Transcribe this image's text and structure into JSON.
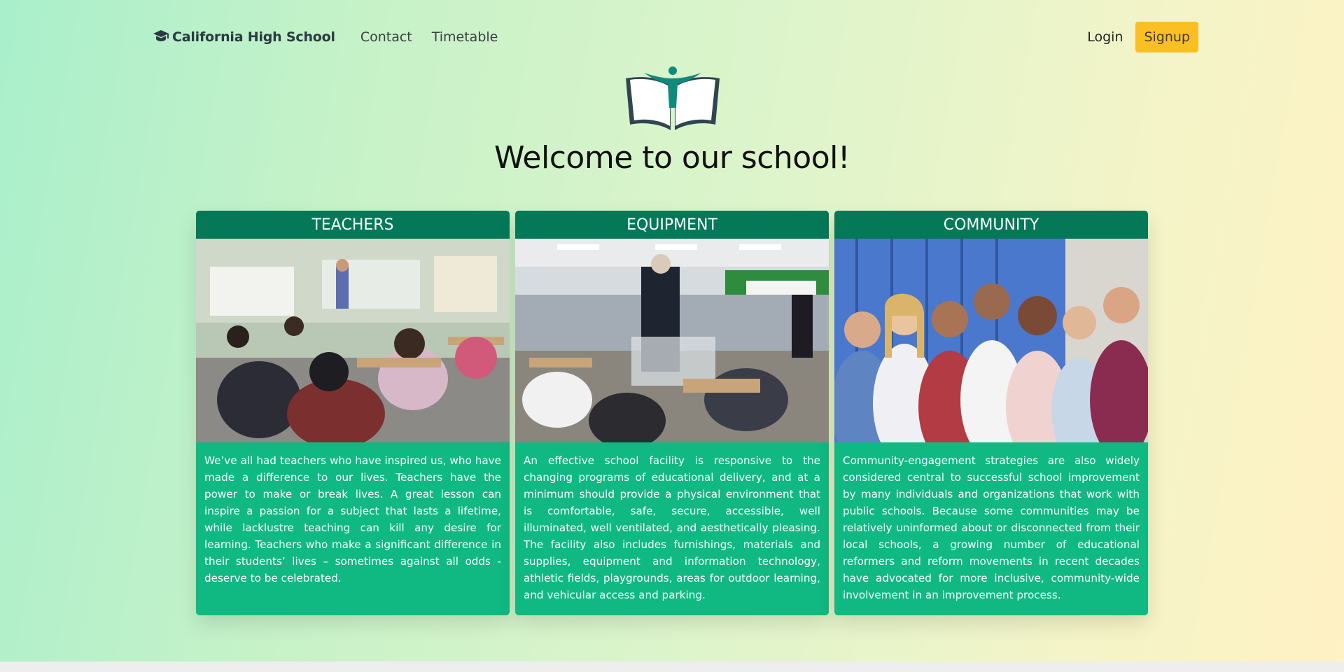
{
  "navbar": {
    "brand": "California High School",
    "links": [
      "Contact",
      "Timetable"
    ],
    "login": "Login",
    "signup": "Signup"
  },
  "hero": {
    "title": "Welcome to our school!"
  },
  "cards": [
    {
      "title": "TEACHERS",
      "image": "classroom-photo",
      "text": "We’ve all had teachers who have inspired us, who have made a difference to our lives. Teachers have the power to make or break lives. A great lesson can inspire a passion for a subject that lasts a lifetime, while lacklustre teaching can kill any desire for learning. Teachers who make a significant difference in their students’ lives – sometimes against all odds - deserve to be celebrated."
    },
    {
      "title": "EQUIPMENT",
      "image": "classroom-visit-photo",
      "text": "An effective school facility is responsive to the changing programs of educational delivery, and at a minimum should provide a physical environment that is comfortable, safe, secure, accessible, well illuminated, well ventilated, and aesthetically pleasing. The facility also includes furnishings, materials and supplies, equipment and information technology, athletic fields, playgrounds, areas for outdoor learning, and vehicular access and parking."
    },
    {
      "title": "COMMUNITY",
      "image": "students-lockers-photo",
      "text": "Community-engagement strategies are also widely considered central to successful school improvement by many individuals and organizations that work with public schools. Because some communities may be relatively uninformed about or disconnected from their local schools, a growing number of educational reformers and reform movements in recent decades have advocated for more inclusive, community-wide involvement in an improvement process."
    }
  ],
  "colors": {
    "card_body": "#10b981",
    "card_header": "#047857",
    "signup_button": "#fbbf24"
  }
}
